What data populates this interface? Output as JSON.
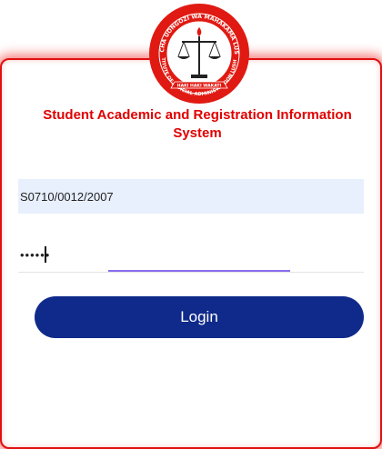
{
  "header": {
    "title": "Student Academic and Registration Information System",
    "logo_text_top": "CHUO CHA UONGOZI WA MAHAKAMA LUSHOTO",
    "logo_text_bottom": "INSTITUTE OF JUDICIAL ADMINISTRATION LUSHOTO",
    "logo_motto": "HAKI HAKI WAKATI"
  },
  "form": {
    "username_value": "S0710/0012/2007",
    "password_value": "••••••",
    "login_label": "Login"
  },
  "colors": {
    "accent_red": "#e00000",
    "button_blue": "#0f2a8a",
    "input_bg": "#e8effd",
    "focus_purple": "#8a6cf0"
  }
}
